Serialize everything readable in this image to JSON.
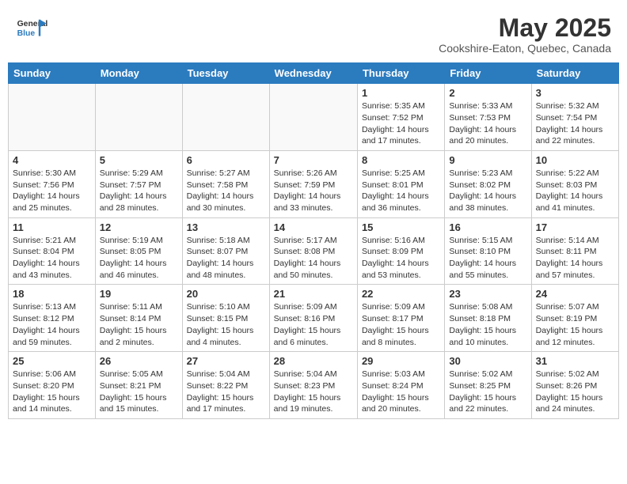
{
  "header": {
    "logo_general": "General",
    "logo_blue": "Blue",
    "title": "May 2025",
    "location": "Cookshire-Eaton, Quebec, Canada"
  },
  "weekdays": [
    "Sunday",
    "Monday",
    "Tuesday",
    "Wednesday",
    "Thursday",
    "Friday",
    "Saturday"
  ],
  "weeks": [
    [
      {
        "day": "",
        "info": ""
      },
      {
        "day": "",
        "info": ""
      },
      {
        "day": "",
        "info": ""
      },
      {
        "day": "",
        "info": ""
      },
      {
        "day": "1",
        "info": "Sunrise: 5:35 AM\nSunset: 7:52 PM\nDaylight: 14 hours\nand 17 minutes."
      },
      {
        "day": "2",
        "info": "Sunrise: 5:33 AM\nSunset: 7:53 PM\nDaylight: 14 hours\nand 20 minutes."
      },
      {
        "day": "3",
        "info": "Sunrise: 5:32 AM\nSunset: 7:54 PM\nDaylight: 14 hours\nand 22 minutes."
      }
    ],
    [
      {
        "day": "4",
        "info": "Sunrise: 5:30 AM\nSunset: 7:56 PM\nDaylight: 14 hours\nand 25 minutes."
      },
      {
        "day": "5",
        "info": "Sunrise: 5:29 AM\nSunset: 7:57 PM\nDaylight: 14 hours\nand 28 minutes."
      },
      {
        "day": "6",
        "info": "Sunrise: 5:27 AM\nSunset: 7:58 PM\nDaylight: 14 hours\nand 30 minutes."
      },
      {
        "day": "7",
        "info": "Sunrise: 5:26 AM\nSunset: 7:59 PM\nDaylight: 14 hours\nand 33 minutes."
      },
      {
        "day": "8",
        "info": "Sunrise: 5:25 AM\nSunset: 8:01 PM\nDaylight: 14 hours\nand 36 minutes."
      },
      {
        "day": "9",
        "info": "Sunrise: 5:23 AM\nSunset: 8:02 PM\nDaylight: 14 hours\nand 38 minutes."
      },
      {
        "day": "10",
        "info": "Sunrise: 5:22 AM\nSunset: 8:03 PM\nDaylight: 14 hours\nand 41 minutes."
      }
    ],
    [
      {
        "day": "11",
        "info": "Sunrise: 5:21 AM\nSunset: 8:04 PM\nDaylight: 14 hours\nand 43 minutes."
      },
      {
        "day": "12",
        "info": "Sunrise: 5:19 AM\nSunset: 8:05 PM\nDaylight: 14 hours\nand 46 minutes."
      },
      {
        "day": "13",
        "info": "Sunrise: 5:18 AM\nSunset: 8:07 PM\nDaylight: 14 hours\nand 48 minutes."
      },
      {
        "day": "14",
        "info": "Sunrise: 5:17 AM\nSunset: 8:08 PM\nDaylight: 14 hours\nand 50 minutes."
      },
      {
        "day": "15",
        "info": "Sunrise: 5:16 AM\nSunset: 8:09 PM\nDaylight: 14 hours\nand 53 minutes."
      },
      {
        "day": "16",
        "info": "Sunrise: 5:15 AM\nSunset: 8:10 PM\nDaylight: 14 hours\nand 55 minutes."
      },
      {
        "day": "17",
        "info": "Sunrise: 5:14 AM\nSunset: 8:11 PM\nDaylight: 14 hours\nand 57 minutes."
      }
    ],
    [
      {
        "day": "18",
        "info": "Sunrise: 5:13 AM\nSunset: 8:12 PM\nDaylight: 14 hours\nand 59 minutes."
      },
      {
        "day": "19",
        "info": "Sunrise: 5:11 AM\nSunset: 8:14 PM\nDaylight: 15 hours\nand 2 minutes."
      },
      {
        "day": "20",
        "info": "Sunrise: 5:10 AM\nSunset: 8:15 PM\nDaylight: 15 hours\nand 4 minutes."
      },
      {
        "day": "21",
        "info": "Sunrise: 5:09 AM\nSunset: 8:16 PM\nDaylight: 15 hours\nand 6 minutes."
      },
      {
        "day": "22",
        "info": "Sunrise: 5:09 AM\nSunset: 8:17 PM\nDaylight: 15 hours\nand 8 minutes."
      },
      {
        "day": "23",
        "info": "Sunrise: 5:08 AM\nSunset: 8:18 PM\nDaylight: 15 hours\nand 10 minutes."
      },
      {
        "day": "24",
        "info": "Sunrise: 5:07 AM\nSunset: 8:19 PM\nDaylight: 15 hours\nand 12 minutes."
      }
    ],
    [
      {
        "day": "25",
        "info": "Sunrise: 5:06 AM\nSunset: 8:20 PM\nDaylight: 15 hours\nand 14 minutes."
      },
      {
        "day": "26",
        "info": "Sunrise: 5:05 AM\nSunset: 8:21 PM\nDaylight: 15 hours\nand 15 minutes."
      },
      {
        "day": "27",
        "info": "Sunrise: 5:04 AM\nSunset: 8:22 PM\nDaylight: 15 hours\nand 17 minutes."
      },
      {
        "day": "28",
        "info": "Sunrise: 5:04 AM\nSunset: 8:23 PM\nDaylight: 15 hours\nand 19 minutes."
      },
      {
        "day": "29",
        "info": "Sunrise: 5:03 AM\nSunset: 8:24 PM\nDaylight: 15 hours\nand 20 minutes."
      },
      {
        "day": "30",
        "info": "Sunrise: 5:02 AM\nSunset: 8:25 PM\nDaylight: 15 hours\nand 22 minutes."
      },
      {
        "day": "31",
        "info": "Sunrise: 5:02 AM\nSunset: 8:26 PM\nDaylight: 15 hours\nand 24 minutes."
      }
    ]
  ]
}
